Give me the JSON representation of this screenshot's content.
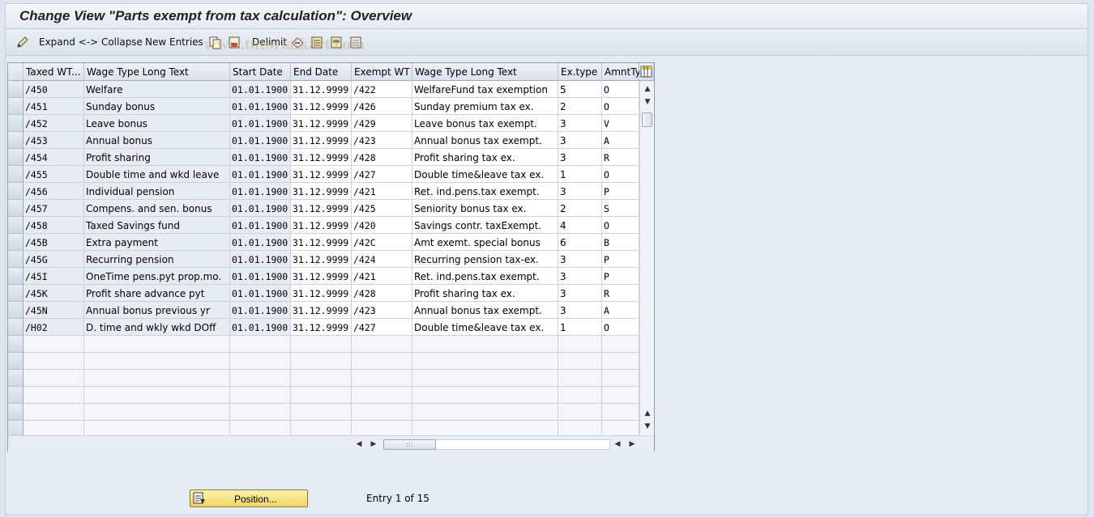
{
  "window": {
    "title": "Change View \"Parts exempt from tax calculation\": Overview"
  },
  "toolbar": {
    "expand_collapse": "Expand <-> Collapse",
    "new_entries": "New Entries",
    "delimit": "Delimit"
  },
  "table": {
    "columns": [
      "Taxed WT...",
      "Wage Type Long Text",
      "Start Date",
      "End Date",
      "Exempt WT",
      "Wage Type Long Text",
      "Ex.type",
      "AmntTy"
    ],
    "rows": [
      [
        "/450",
        "Welfare",
        "01.01.1900",
        "31.12.9999",
        "/422",
        "WelfareFund tax exemption",
        "5",
        "O"
      ],
      [
        "/451",
        "Sunday bonus",
        "01.01.1900",
        "31.12.9999",
        "/426",
        "Sunday premium tax ex.",
        "2",
        "O"
      ],
      [
        "/452",
        "Leave bonus",
        "01.01.1900",
        "31.12.9999",
        "/429",
        "Leave bonus tax exempt.",
        "3",
        "V"
      ],
      [
        "/453",
        "Annual bonus",
        "01.01.1900",
        "31.12.9999",
        "/423",
        "Annual bonus tax exempt.",
        "3",
        "A"
      ],
      [
        "/454",
        "Profit sharing",
        "01.01.1900",
        "31.12.9999",
        "/428",
        "Profit sharing tax ex.",
        "3",
        "R"
      ],
      [
        "/455",
        "Double time and wkd leave",
        "01.01.1900",
        "31.12.9999",
        "/427",
        "Double time&leave tax ex.",
        "1",
        "O"
      ],
      [
        "/456",
        "Individual pension",
        "01.01.1900",
        "31.12.9999",
        "/421",
        "Ret. ind.pens.tax exempt.",
        "3",
        "P"
      ],
      [
        "/457",
        "Compens. and sen. bonus",
        "01.01.1900",
        "31.12.9999",
        "/425",
        "Seniority bonus tax ex.",
        "2",
        "S"
      ],
      [
        "/458",
        "Taxed Savings fund",
        "01.01.1900",
        "31.12.9999",
        "/420",
        "Savings contr. taxExempt.",
        "4",
        "O"
      ],
      [
        "/45B",
        "Extra payment",
        "01.01.1900",
        "31.12.9999",
        "/42C",
        "Amt exemt. special bonus",
        "6",
        "B"
      ],
      [
        "/45G",
        "Recurring pension",
        "01.01.1900",
        "31.12.9999",
        "/424",
        "Recurring pension tax-ex.",
        "3",
        "P"
      ],
      [
        "/45I",
        "OneTime pens.pyt prop.mo.",
        "01.01.1900",
        "31.12.9999",
        "/421",
        "Ret. ind.pens.tax exempt.",
        "3",
        "P"
      ],
      [
        "/45K",
        "Profit share advance pyt",
        "01.01.1900",
        "31.12.9999",
        "/428",
        "Profit sharing tax ex.",
        "3",
        "R"
      ],
      [
        "/45N",
        "Annual bonus previous yr",
        "01.01.1900",
        "31.12.9999",
        "/423",
        "Annual bonus tax exempt.",
        "3",
        "A"
      ],
      [
        "/H02",
        "D. time and wkly wkd DOff",
        "01.01.1900",
        "31.12.9999",
        "/427",
        "Double time&leave tax ex.",
        "1",
        "O"
      ]
    ],
    "empty_rows": 6
  },
  "footer": {
    "position_button": "Position...",
    "entry_text": "Entry 1 of 15"
  },
  "icons": {
    "edit": "pencil-icon",
    "copy": "copy-icon",
    "save": "save-icon",
    "delimit": "delimit-icon",
    "select_all": "select-all-icon",
    "select_block": "select-block-icon",
    "deselect": "deselect-all-icon",
    "column_config": "column-settings-icon"
  },
  "colors": {
    "header_bg": "#dbe2ea",
    "key_cell_bg": "#e7ecf3",
    "position_button": "#f0d565"
  }
}
